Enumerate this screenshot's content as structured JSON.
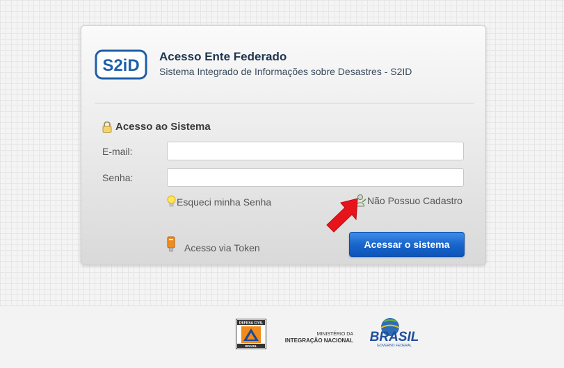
{
  "header": {
    "logo_text": "S2iD",
    "title": "Acesso Ente Federado",
    "subtitle": "Sistema Integrado de Informações sobre Desastres - S2ID"
  },
  "form": {
    "section_title": "Acesso ao Sistema",
    "email_label": "E-mail:",
    "email_value": "",
    "password_label": "Senha:",
    "password_value": "",
    "forgot_password": "Esqueci minha Senha",
    "no_account": "Não Possuo Cadastro",
    "token_access": "Acesso via Token",
    "submit_label": "Acessar o sistema"
  },
  "footer": {
    "defesa_civil_top": "DEFESA CIVIL",
    "defesa_civil_bottom": "BRASIL",
    "ministry_line1": "MINISTÉRIO DA",
    "ministry_line2": "INTEGRAÇÃO NACIONAL",
    "brasil_text": "BRASIL",
    "brasil_sub": "GOVERNO FEDERAL"
  },
  "colors": {
    "accent_blue": "#1a66cc",
    "title_navy": "#1f3550",
    "annotation_red": "#e8141b"
  },
  "icons": {
    "lock": "lock-icon",
    "bulb": "lightbulb-icon",
    "user": "user-icon",
    "token": "usb-token-icon",
    "arrow": "red-arrow-annotation"
  }
}
